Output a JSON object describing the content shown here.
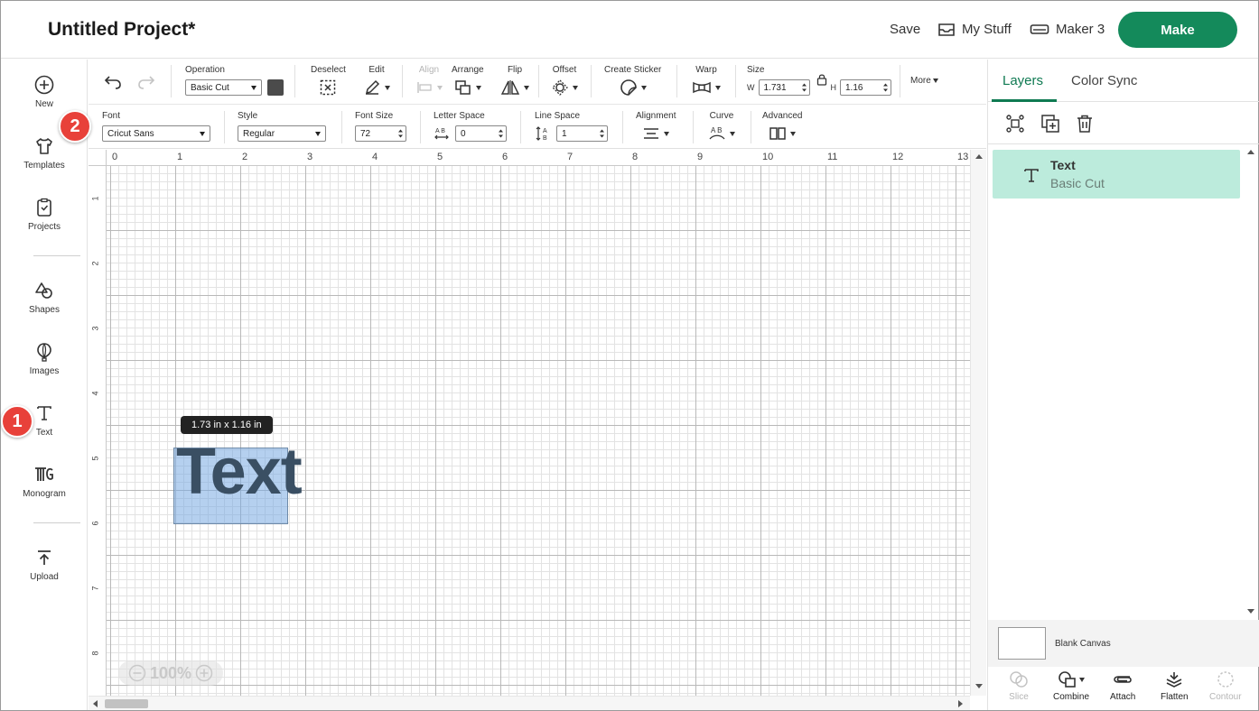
{
  "header": {
    "title": "Untitled Project*",
    "save": "Save",
    "my_stuff": "My Stuff",
    "machine": "Maker 3",
    "make": "Make"
  },
  "sidebar": {
    "items": [
      {
        "label": "New",
        "icon": "plus-circle-icon"
      },
      {
        "label": "Templates",
        "icon": "tshirt-icon"
      },
      {
        "label": "Projects",
        "icon": "clipboard-icon"
      },
      {
        "label": "Shapes",
        "icon": "shapes-icon"
      },
      {
        "label": "Images",
        "icon": "balloon-icon"
      },
      {
        "label": "Text",
        "icon": "text-t-icon"
      },
      {
        "label": "Monogram",
        "icon": "monogram-icon"
      },
      {
        "label": "Upload",
        "icon": "upload-icon"
      }
    ]
  },
  "badges": {
    "one": "1",
    "two": "2"
  },
  "toolbar1": {
    "operation_label": "Operation",
    "operation_value": "Basic Cut",
    "deselect": "Deselect",
    "edit": "Edit",
    "align": "Align",
    "arrange": "Arrange",
    "flip": "Flip",
    "offset": "Offset",
    "create_sticker": "Create Sticker",
    "warp": "Warp",
    "size_label": "Size",
    "w_label": "W",
    "w_value": "1.731",
    "h_label": "H",
    "h_value": "1.16",
    "more": "More"
  },
  "toolbar2": {
    "font_label": "Font",
    "font_value": "Cricut Sans",
    "style_label": "Style",
    "style_value": "Regular",
    "font_size_label": "Font Size",
    "font_size_value": "72",
    "letter_space_label": "Letter Space",
    "letter_space_value": "0",
    "line_space_label": "Line Space",
    "line_space_value": "1",
    "alignment_label": "Alignment",
    "curve_label": "Curve",
    "advanced_label": "Advanced"
  },
  "canvas": {
    "ruler_top": [
      "0",
      "1",
      "2",
      "3",
      "4",
      "5",
      "6",
      "7",
      "8",
      "9",
      "10",
      "11",
      "12",
      "13"
    ],
    "ruler_left": [
      "1",
      "2",
      "3",
      "4",
      "5",
      "6",
      "7",
      "8"
    ],
    "text_object": "Text",
    "dimensions": "1.73  in x 1.16  in",
    "zoom": "100%"
  },
  "panel": {
    "tabs": [
      "Layers",
      "Color Sync"
    ],
    "layer_name": "Text",
    "layer_operation": "Basic Cut",
    "blank_canvas": "Blank Canvas",
    "bottom_tools": [
      "Slice",
      "Combine",
      "Attach",
      "Flatten",
      "Contour"
    ]
  },
  "colors": {
    "accent": "#148a5b",
    "layer_highlight": "#bcebdc",
    "badge": "#e8413a",
    "selection": "#78aae1"
  }
}
